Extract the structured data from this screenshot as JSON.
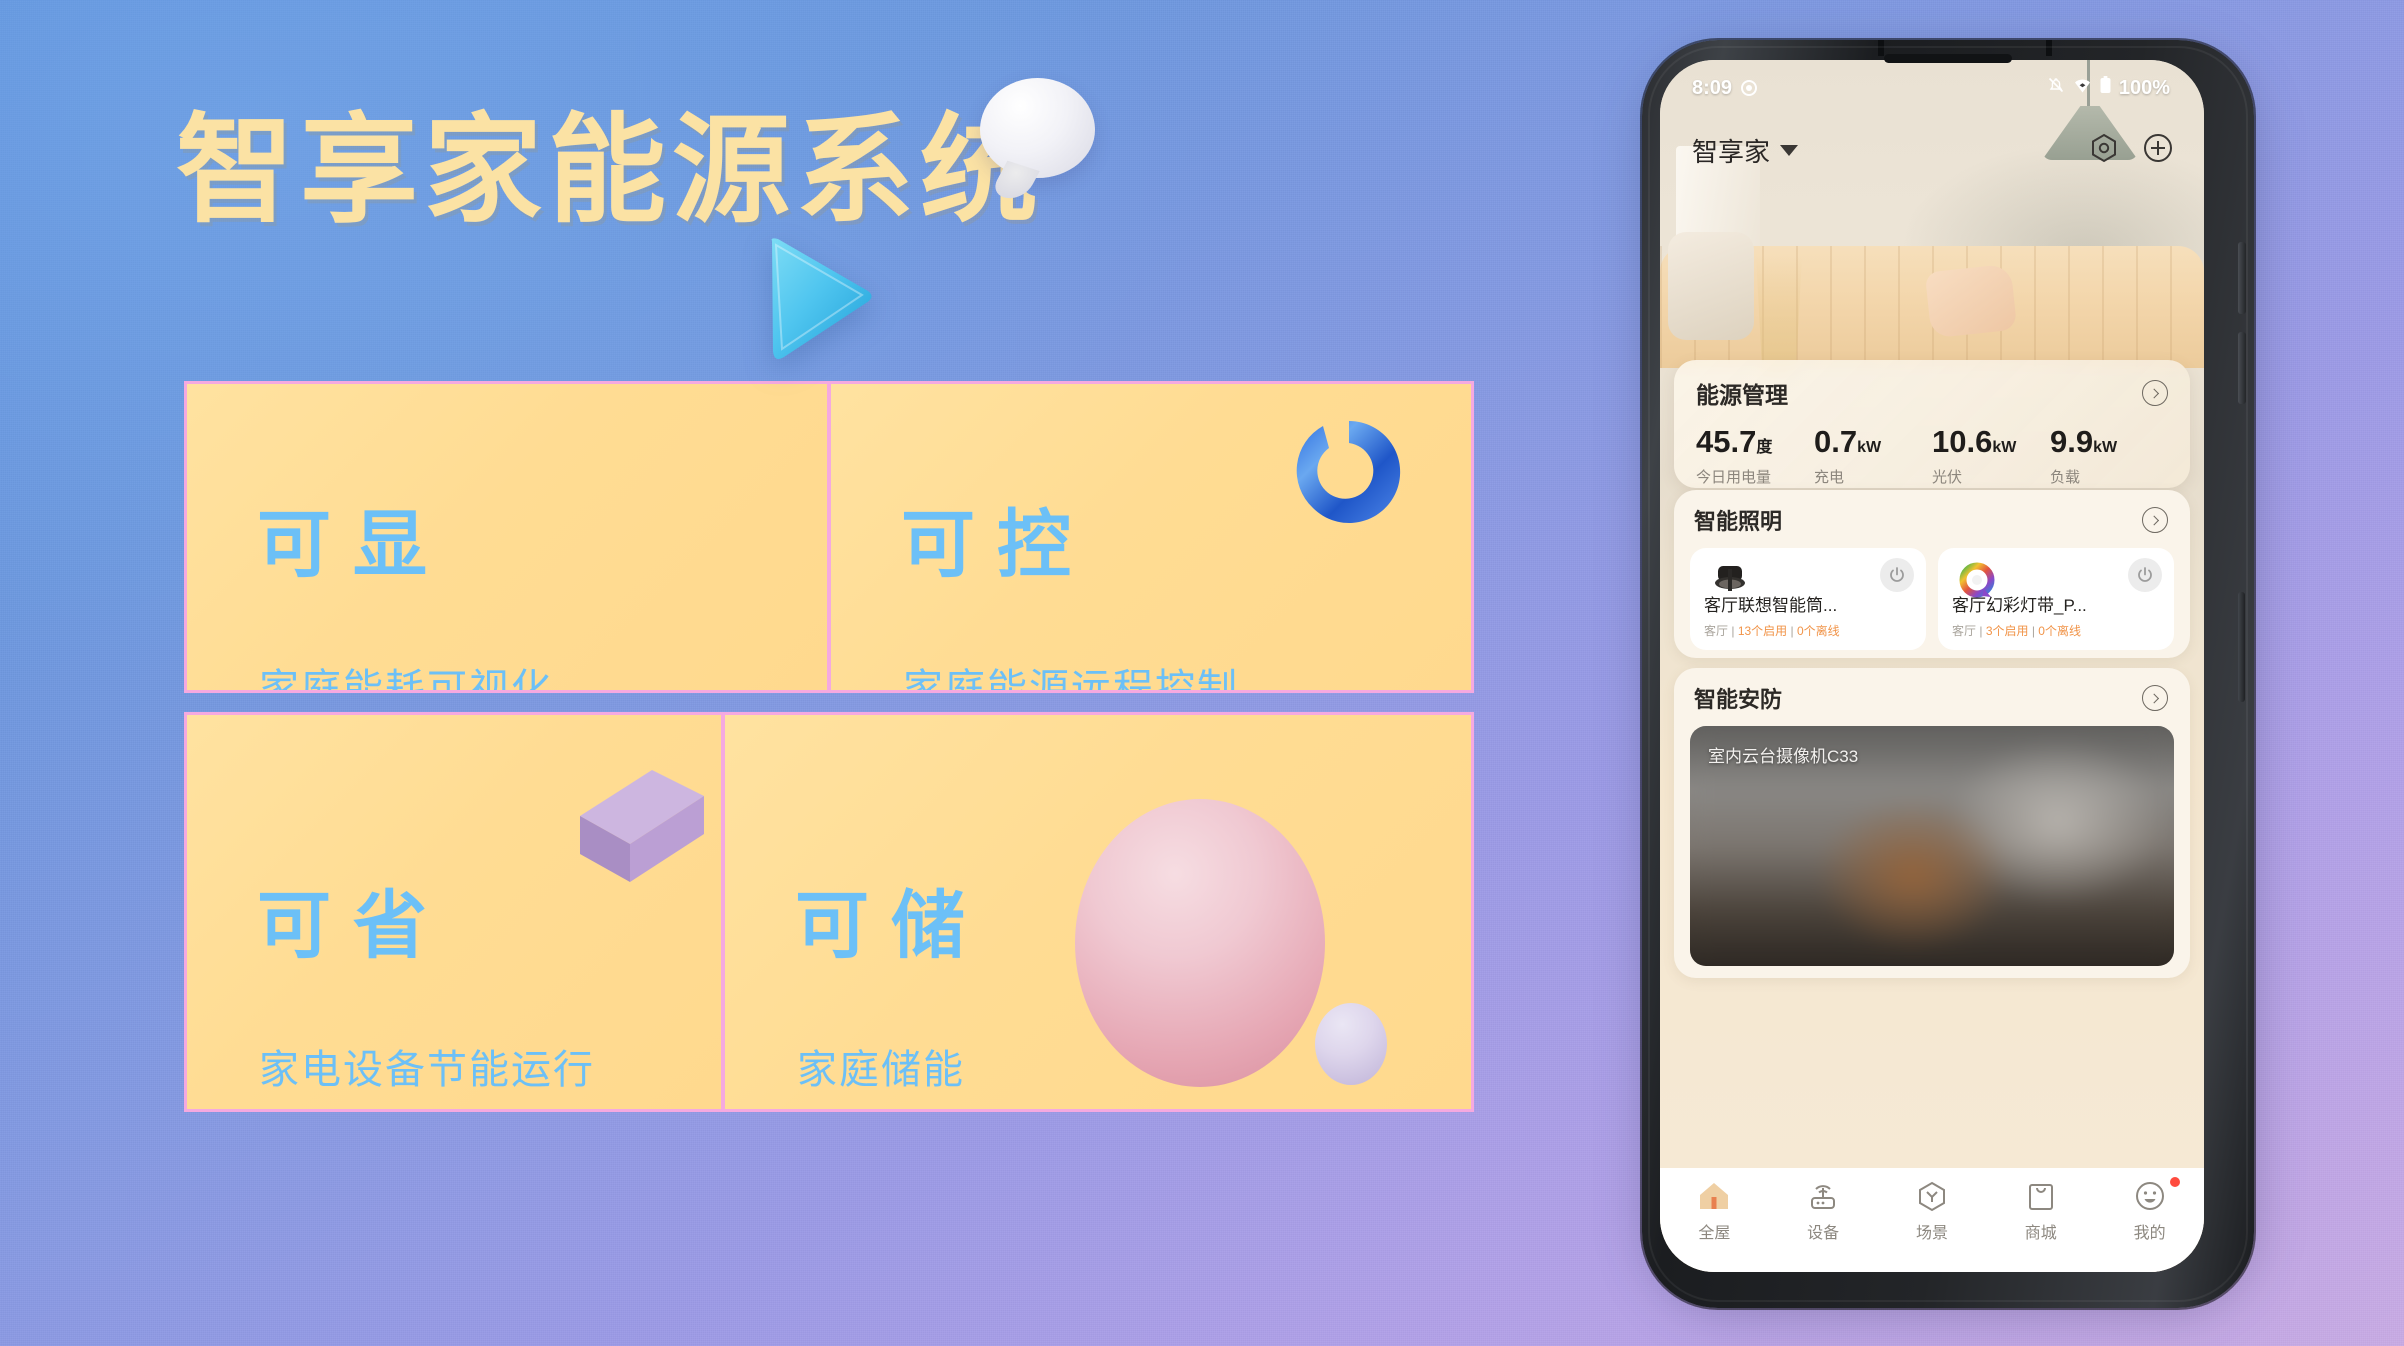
{
  "poster": {
    "title": "智享家能源系统",
    "title_color": "#fbe2a4",
    "bubble_icon": "speech-bubble-3d",
    "background_colors": [
      "#5d91dc",
      "#9b9ae6",
      "#c8abe4"
    ]
  },
  "feature_cards": [
    {
      "id": "card-1",
      "title": "可显",
      "subtitle": "家庭能耗可视化",
      "decoration": "blue-triangle-3d",
      "title_color": "#6cc0f7",
      "card_color": "#ffdc93",
      "border_color": "#f5a9e0"
    },
    {
      "id": "card-2",
      "title": "可控",
      "subtitle": "家庭能源远程控制",
      "decoration": "blue-torus-3d",
      "title_color": "#6cc0f7",
      "card_color": "#ffdc93",
      "border_color": "#f5a9e0"
    },
    {
      "id": "card-3",
      "title": "可省",
      "subtitle": "家电设备节能运行",
      "decoration": "purple-cube-3d",
      "title_color": "#6cc0f7",
      "card_color": "#ffdc93",
      "border_color": "#f5a9e0"
    },
    {
      "id": "card-4",
      "title": "可储",
      "subtitle": "家庭储能",
      "decoration": "pink-sphere-3d",
      "title_color": "#6cc0f7",
      "card_color": "#ffdc93",
      "border_color": "#f5a9e0"
    }
  ],
  "phone": {
    "statusbar": {
      "time": "8:09",
      "camera_icon": "camera-dot-icon",
      "mute_icon": "bell-muted-icon",
      "wifi_icon": "wifi-icon",
      "battery_icon": "battery-full-icon",
      "battery_text": "100%"
    },
    "app_header": {
      "home_name": "智享家",
      "dropdown_icon": "chevron-down-icon",
      "scene_icon": "hexagon-gear-icon",
      "add_icon": "plus-circle-icon"
    },
    "energy_card": {
      "title": "能源管理",
      "more_icon": "chevron-right-icon",
      "stats": [
        {
          "value": "45.7",
          "unit": "度",
          "label": "今日用电量"
        },
        {
          "value": "0.7",
          "unit": "kW",
          "label": "充电"
        },
        {
          "value": "10.6",
          "unit": "kW",
          "label": "光伏"
        },
        {
          "value": "9.9",
          "unit": "kW",
          "label": "负载"
        }
      ]
    },
    "lighting_section": {
      "title": "智能照明",
      "more_icon": "chevron-right-icon",
      "devices": [
        {
          "name": "客厅联想智能筒...",
          "room": "客厅",
          "enabled": "13个启用",
          "offline": "0个离线",
          "icon": "downlight-icon",
          "power_icon": "power-icon"
        },
        {
          "name": "客厅幻彩灯带_P...",
          "room": "客厅",
          "enabled": "3个启用",
          "offline": "0个离线",
          "icon": "rgb-lightstrip-icon",
          "power_icon": "power-icon"
        }
      ],
      "accent_color": "#f19449"
    },
    "security_section": {
      "title": "智能安防",
      "more_icon": "chevron-right-icon",
      "camera": {
        "label": "室内云台摄像机C33",
        "feed_state": "blurred-live-feed"
      }
    },
    "bottom_nav": [
      {
        "label": "全屋",
        "icon": "home-icon",
        "active": true,
        "badge": false
      },
      {
        "label": "设备",
        "icon": "router-icon",
        "active": false,
        "badge": false
      },
      {
        "label": "场景",
        "icon": "hexagon-scene-icon",
        "active": false,
        "badge": false
      },
      {
        "label": "商城",
        "icon": "shopping-bag-icon",
        "active": false,
        "badge": false
      },
      {
        "label": "我的",
        "icon": "smiley-profile-icon",
        "active": false,
        "badge": true
      }
    ]
  }
}
